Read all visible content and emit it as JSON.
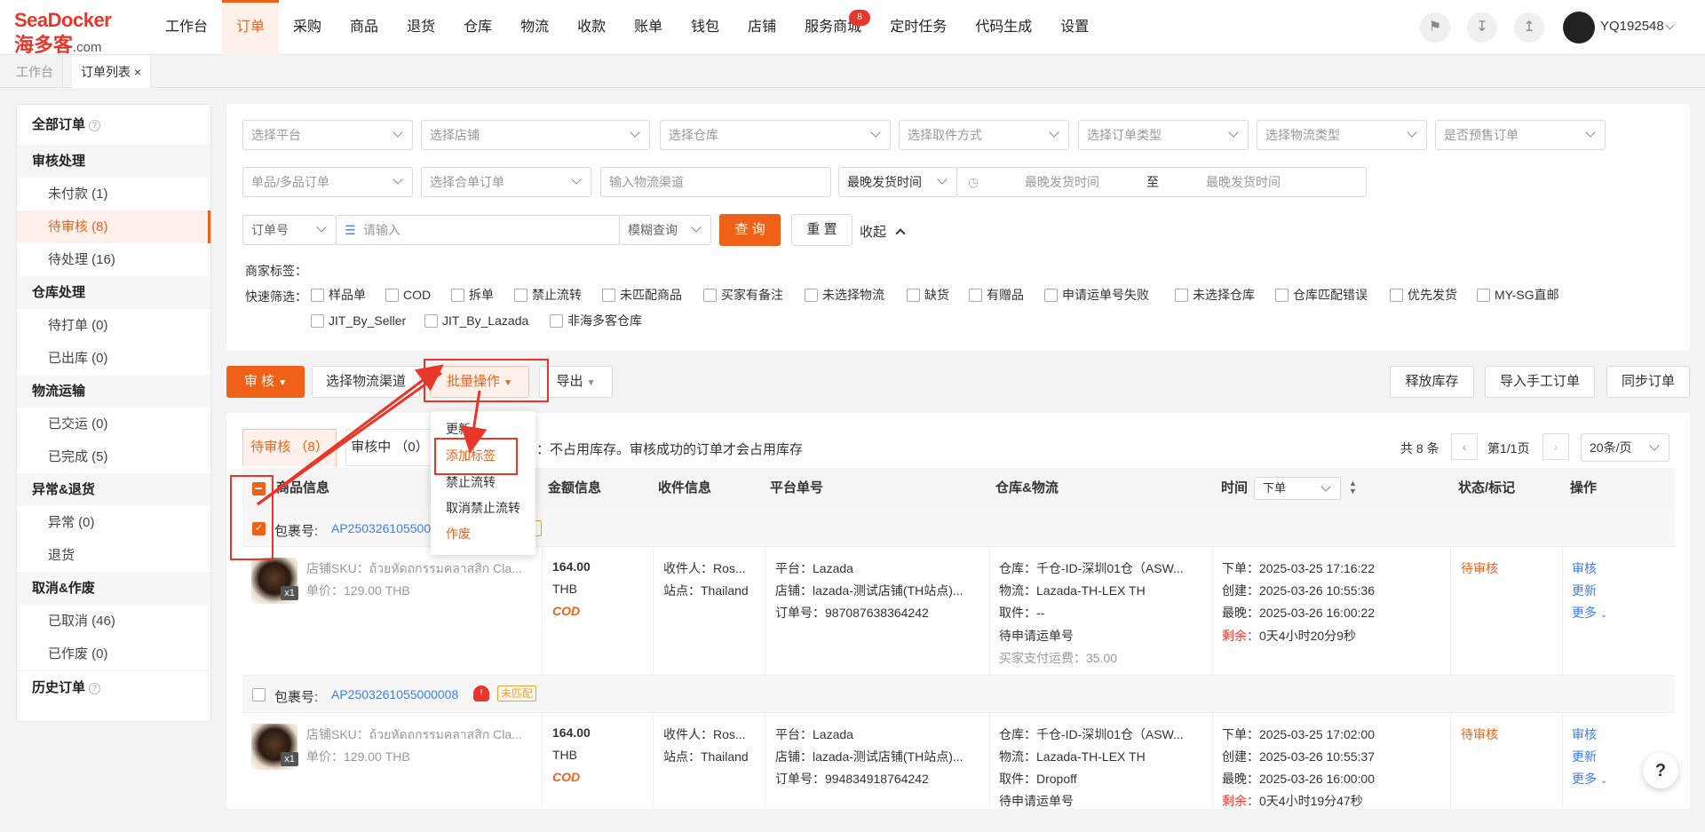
{
  "brand": {
    "logo_top": "SeaDocker",
    "logo_cn": "海多客",
    "logo_domain": ".com"
  },
  "nav": [
    "工作台",
    "订单",
    "采购",
    "商品",
    "退货",
    "仓库",
    "物流",
    "收款",
    "账单",
    "钱包",
    "店铺",
    "服务商城",
    "定时任务",
    "代码生成",
    "设置"
  ],
  "nav_badge": "8",
  "user": {
    "name": "YQ192548"
  },
  "tabs": [
    "工作台",
    "订单列表"
  ],
  "tab_close": "×",
  "sidebar": {
    "all": "全部订单",
    "audit_group": "审核处理",
    "unpaid": "未付款 (1)",
    "pending_audit": "待审核 (8)",
    "pending_handle": "待处理 (16)",
    "wh_group": "仓库处理",
    "to_print": "待打单 (0)",
    "shipped": "已出库 (0)",
    "log_group": "物流运输",
    "delivered": "已交运 (0)",
    "completed": "已完成 (5)",
    "exc_group": "异常&退货",
    "exception": "异常 (0)",
    "returns": "退货",
    "cancel_group": "取消&作废",
    "cancelled": "已取消 (46)",
    "voided": "已作废 (0)",
    "history": "历史订单"
  },
  "filters": {
    "platform": "选择平台",
    "shop": "选择店铺",
    "warehouse": "选择仓库",
    "pickup": "选择取件方式",
    "order_type": "选择订单类型",
    "logistics_type": "选择物流类型",
    "presale": "是否预售订单",
    "single_multi": "单品/多品订单",
    "merge": "选择合单订单",
    "channel": "输入物流渠道",
    "ship_time_sel": "最晚发货时间",
    "start_time": "最晚发货时间",
    "to": "至",
    "end_time": "最晚发货时间",
    "order_no": "订单号",
    "input_ph": "请输入",
    "fuzzy": "模糊查询",
    "search": "查 询",
    "reset": "重 置",
    "collapse": "收起",
    "merchant_tag": "商家标签：",
    "quick": "快速筛选："
  },
  "quick_filters": [
    "样品单",
    "COD",
    "拆单",
    "禁止流转",
    "未匹配商品",
    "买家有备注",
    "未选择物流",
    "缺货",
    "有赠品",
    "申请运单号失败",
    "未选择仓库",
    "仓库匹配错误",
    "优先发货",
    "MY-SG直邮",
    "JIT_By_Seller",
    "JIT_By_Lazada",
    "非海多客仓库"
  ],
  "toolbar": {
    "audit": "审 核",
    "choose_channel": "选择物流渠道",
    "batch": "批量操作",
    "export": "导出",
    "release": "释放库存",
    "import_manual": "导入手工订单",
    "sync": "同步订单"
  },
  "batch_menu": [
    "更新",
    "添加标签",
    "禁止流转",
    "取消禁止流转",
    "作废"
  ],
  "subtabs": {
    "pending": "待审核 （8）",
    "auditing": "审核中 （0）",
    "note": "单：不占用库存。审核成功的订单才会占用库存"
  },
  "pager": {
    "total": "共 8 条",
    "page": "第1/1页",
    "size": "20条/页"
  },
  "columns": {
    "product": "商品信息",
    "amount": "金额信息",
    "receiver": "收件信息",
    "platform_no": "平台单号",
    "wh_log": "仓库&物流",
    "time": "时间",
    "time_sel": "下单",
    "status": "状态/标记",
    "ops": "操作"
  },
  "orders": [
    {
      "pkg_label": "包裹号:",
      "pkg": "AP250326105500",
      "shop_sku": "店铺SKU：ถ้วยหัดถกรรมคลาสสิก Cla...",
      "unit_price": "单价：129.00 THB",
      "qty": "x1",
      "amount": "164.00",
      "currency": "THB",
      "cod": "COD",
      "receiver": "收件人：Ros...",
      "site": "站点：Thailand",
      "platform": "平台：Lazada",
      "shop": "店铺：lazada-测试店铺(TH站点)...",
      "order_no": "订单号：987087638364242",
      "wh": "仓库：千仓-ID-深圳01仓（ASW...",
      "logistics": "物流：Lazada-TH-LEX TH",
      "pickup": "取件：--",
      "pending_wb": "待申请运单号",
      "buyer_fee": "买家支付运费：35.00",
      "order_time": "下单：2025-03-25 17:16:22",
      "created": "创建：2025-03-26 10:55:36",
      "latest": "最晚：2025-03-26 16:00:22",
      "remain_label": "剩余：",
      "remain": "0天4小时20分9秒",
      "status": "待审核",
      "op1": "审核",
      "op2": "更新",
      "op3": "更多"
    },
    {
      "pkg_label": "包裹号:",
      "pkg": "AP2503261055000008",
      "tag": "未匹配",
      "shop_sku": "店铺SKU：ถ้วยหัดถกรรมคลาสสิก Cla...",
      "unit_price": "单价：129.00 THB",
      "qty": "x1",
      "amount": "164.00",
      "currency": "THB",
      "cod": "COD",
      "receiver": "收件人：Ros...",
      "site": "站点：Thailand",
      "platform": "平台：Lazada",
      "shop": "店铺：lazada-测试店铺(TH站点)...",
      "order_no": "订单号：994834918764242",
      "wh": "仓库：千仓-ID-深圳01仓（ASW...",
      "logistics": "物流：Lazada-TH-LEX TH",
      "pickup": "取件：Dropoff",
      "pending_wb": "待申请运单号",
      "order_time": "下单：2025-03-25 17:02:00",
      "created": "创建：2025-03-26 10:55:37",
      "latest": "最晚：2025-03-26 16:00:00",
      "remain_label": "剩余：",
      "remain": "0天4小时19分47秒",
      "status": "待审核",
      "op1": "审核",
      "op2": "更新",
      "op3": "更多"
    }
  ],
  "help": "?"
}
